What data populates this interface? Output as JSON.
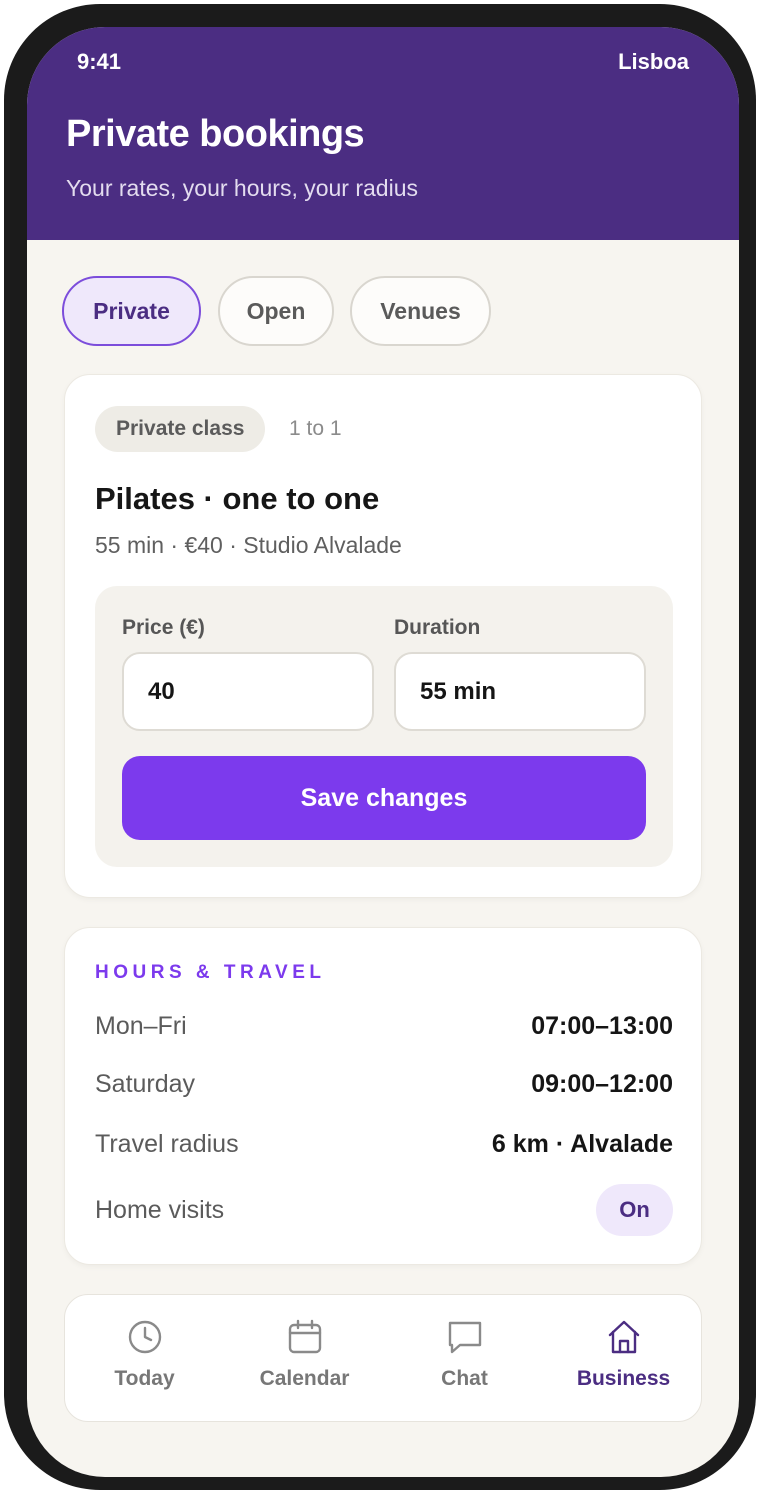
{
  "status_bar": {
    "time": "9:41",
    "location": "Lisboa"
  },
  "header": {
    "title": "Private bookings",
    "subtitle": "Your rates, your hours, your radius"
  },
  "segments": [
    {
      "label": "Private",
      "active": true
    },
    {
      "label": "Open",
      "active": false
    },
    {
      "label": "Venues",
      "active": false
    }
  ],
  "class_card": {
    "badge": "Private class",
    "type": "1 to 1",
    "title": "Pilates · one to one",
    "meta": "55 min · €40 · Studio Alvalade",
    "price_label": "Price (€)",
    "price_value": "40",
    "duration_label": "Duration",
    "duration_value": "55 min",
    "save_label": "Save changes"
  },
  "hours": {
    "section_label": "HOURS & TRAVEL",
    "rows": [
      {
        "label": "Mon–Fri",
        "value": "07:00–13:00"
      },
      {
        "label": "Saturday",
        "value": "09:00–12:00"
      },
      {
        "label": "Travel radius",
        "value": "6 km · Alvalade"
      }
    ],
    "home_visits": {
      "label": "Home visits",
      "toggle": "On"
    }
  },
  "tabbar": [
    {
      "label": "Today",
      "icon": "clock-icon",
      "active": false
    },
    {
      "label": "Calendar",
      "icon": "calendar-icon",
      "active": false
    },
    {
      "label": "Chat",
      "icon": "chat-bubble-icon",
      "active": false
    },
    {
      "label": "Business",
      "icon": "storefront-icon",
      "active": true
    }
  ],
  "colors": {
    "brand": "#4b2d82",
    "accent": "#7c3aed",
    "background": "#f7f5f0"
  }
}
